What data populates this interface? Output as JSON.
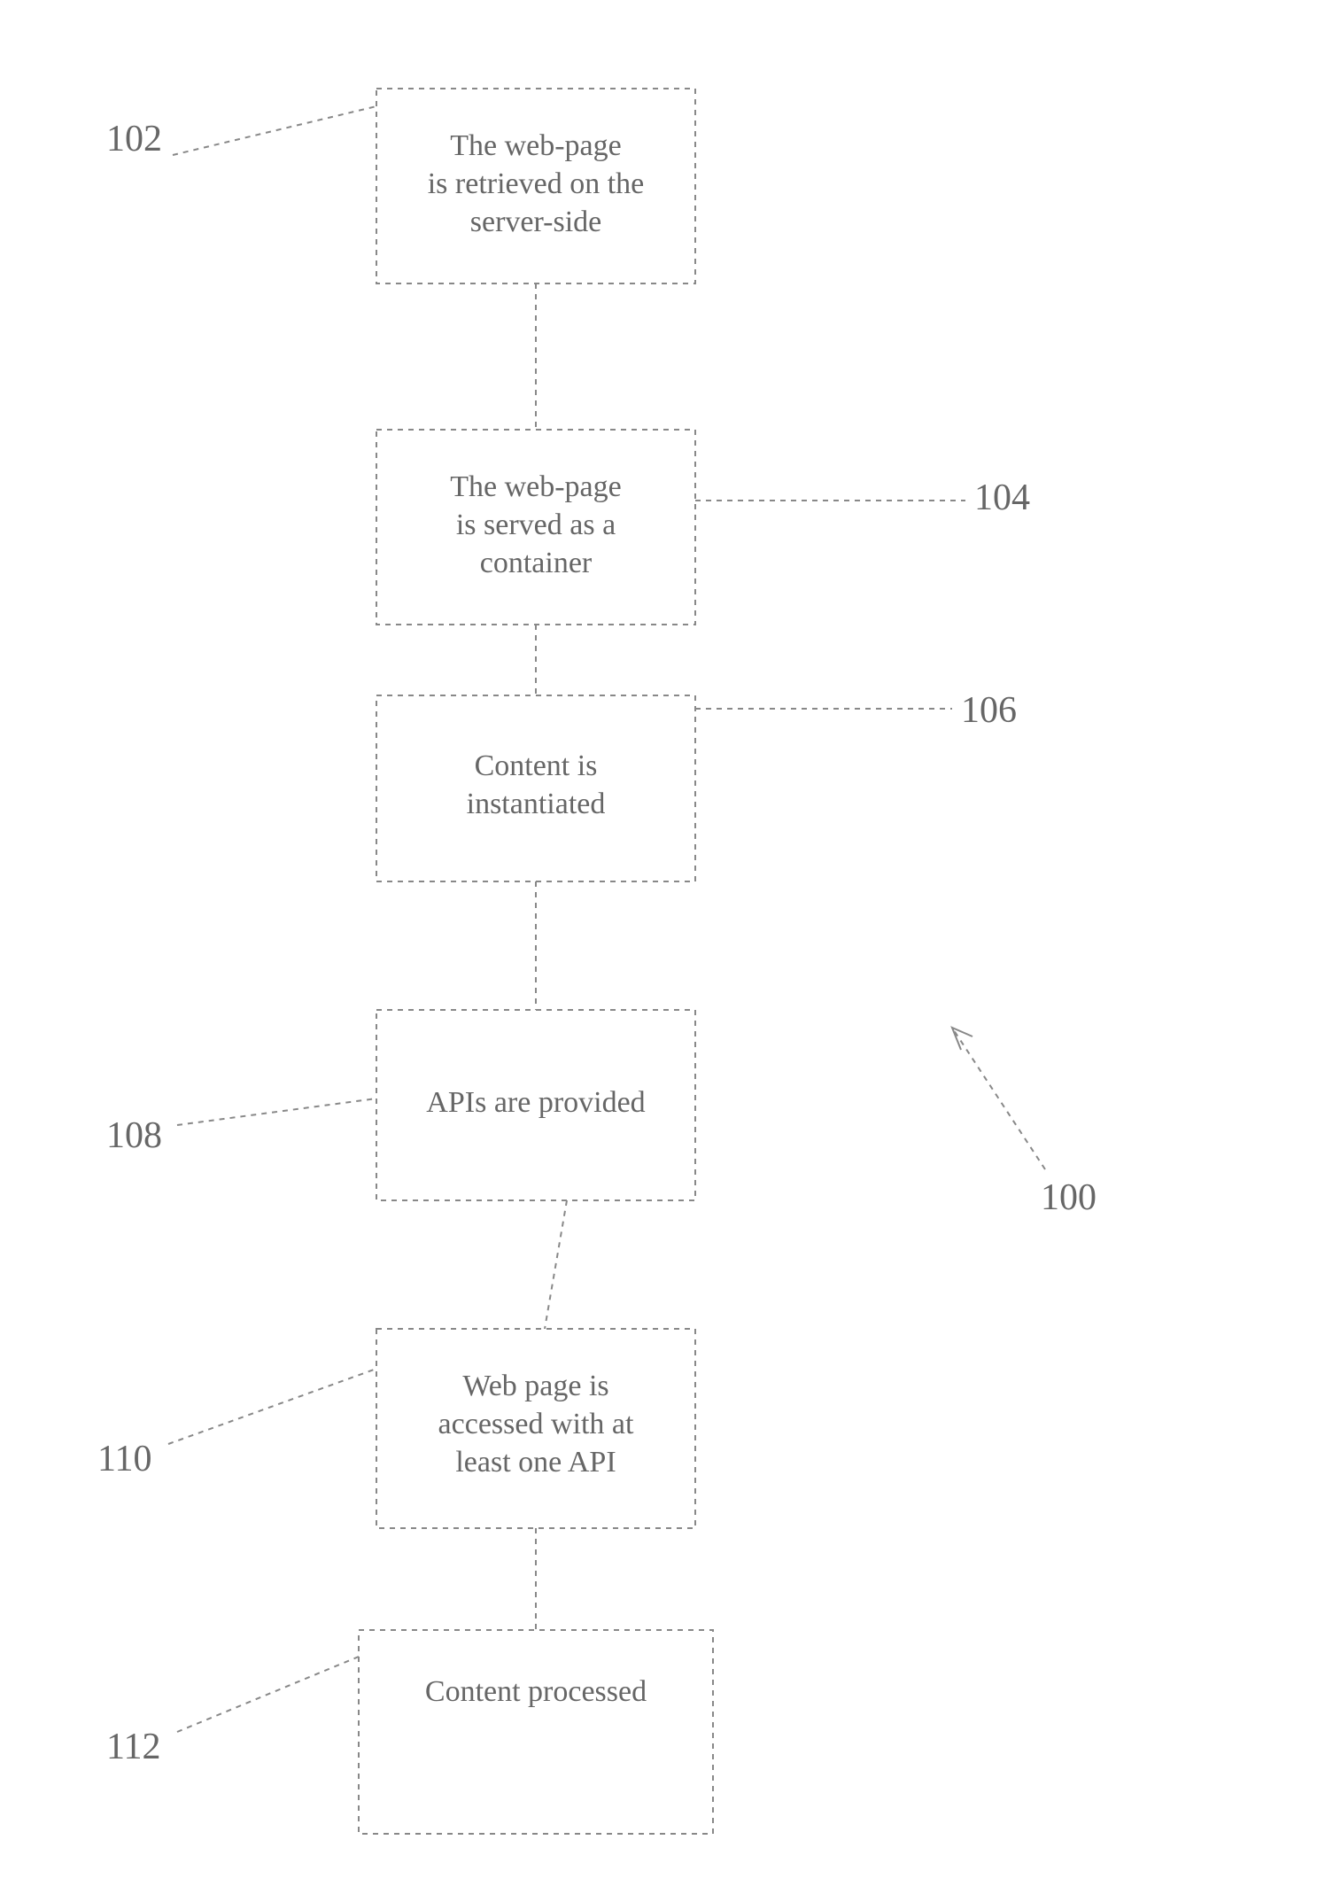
{
  "diagram": {
    "reference_labels": {
      "l102": "102",
      "l104": "104",
      "l106": "106",
      "l108": "108",
      "l110": "110",
      "l112": "112",
      "l100": "100"
    },
    "boxes": {
      "b102": {
        "line1": "The web-page",
        "line2": "is retrieved on the",
        "line3": "server-side"
      },
      "b104": {
        "line1": "The web-page",
        "line2": "is served as a",
        "line3": "container"
      },
      "b106": {
        "line1": "Content is",
        "line2": "instantiated"
      },
      "b108": {
        "line1": "APIs are provided"
      },
      "b110": {
        "line1": "Web page is",
        "line2": "accessed with at",
        "line3": "least one API"
      },
      "b112": {
        "line1": "Content processed"
      }
    }
  }
}
